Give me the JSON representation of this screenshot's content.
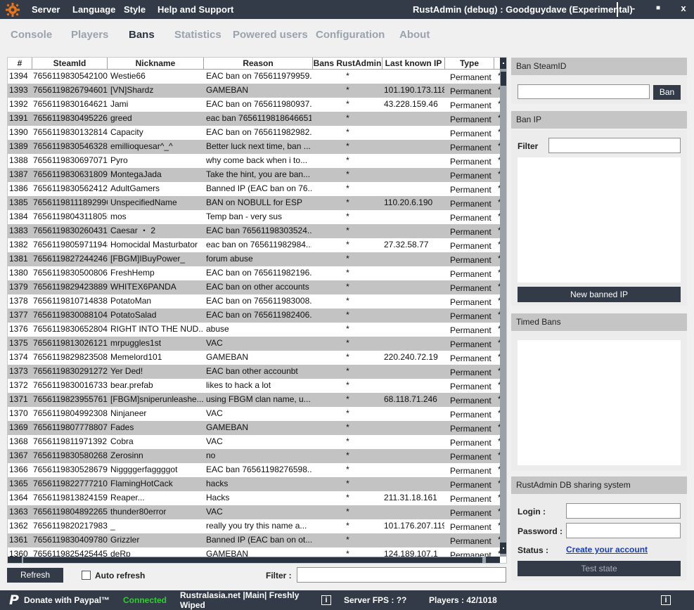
{
  "titlebar": {
    "menu": [
      "Server",
      "Language",
      "Style",
      "Help and Support"
    ],
    "title": "RustAdmin (debug) : Goodguydave (Experimental)",
    "minimize": "-",
    "maximize": "■",
    "close": "x"
  },
  "tabs": [
    "Console",
    "Players",
    "Bans",
    "Statistics",
    "Powered users",
    "Configuration",
    "About"
  ],
  "grid": {
    "columns": [
      "#",
      "SteamId",
      "Nickname",
      "Reason",
      "Bans RustAdmin",
      "Last known IP",
      "Type"
    ],
    "rows": [
      [
        "1394",
        "76561198305421006",
        "Westie66",
        "EAC ban on 765611979959...",
        "*",
        "",
        "Permanent"
      ],
      [
        "1393",
        "76561198267946018",
        "[VN]Shardz",
        "GAMEBAN",
        "*",
        "101.190.173.118",
        "Permanent"
      ],
      [
        "1392",
        "76561198301646210",
        "Jami",
        "EAC ban on 765611980937...",
        "*",
        "43.228.159.46",
        "Permanent"
      ],
      [
        "1391",
        "76561198304952269",
        "greed",
        "eac ban 76561198186466518",
        "*",
        "",
        "Permanent"
      ],
      [
        "1390",
        "76561198301328147",
        "Capacity",
        "EAC ban on 765611982982...",
        "*",
        "",
        "Permanent"
      ],
      [
        "1389",
        "76561198305463286",
        "emillioquesar^_^",
        "Better luck next time, ban ...",
        "*",
        "",
        "Permanent"
      ],
      [
        "1388",
        "76561198306970713",
        "Pyro",
        "why come back when i to...",
        "*",
        "",
        "Permanent"
      ],
      [
        "1387",
        "76561198306318098",
        "MontegaJada",
        "Take the hint, you are ban...",
        "*",
        "",
        "Permanent"
      ],
      [
        "1386",
        "76561198305624124",
        "AdultGamers",
        "Banned IP (EAC ban on 76...",
        "*",
        "",
        "Permanent"
      ],
      [
        "1385",
        "76561198111892996",
        "UnspecifiedName",
        "BAN on NOBULL for ESP",
        "*",
        "110.20.6.190",
        "Permanent"
      ],
      [
        "1384",
        "76561198043118055",
        "mos",
        "Temp ban - very sus",
        "*",
        "",
        "Permanent"
      ],
      [
        "1383",
        "76561198302604316",
        "Caesar ・ 2",
        "EAC ban 76561198303524...",
        "*",
        "",
        "Permanent"
      ],
      [
        "1382",
        "76561198059711948",
        "Homocidal Masturbator",
        "eac ban on 765611982984...",
        "*",
        "27.32.58.77",
        "Permanent"
      ],
      [
        "1381",
        "76561198272442464",
        "[FBGM]IBuyPower_",
        "forum abuse",
        "*",
        "",
        "Permanent"
      ],
      [
        "1380",
        "76561198305008061",
        "FreshHemp",
        "EAC ban on 765611982196...",
        "*",
        "",
        "Permanent"
      ],
      [
        "1379",
        "76561198294238898",
        "WHITEX6PANDA",
        "EAC ban on other accounts",
        "*",
        "",
        "Permanent"
      ],
      [
        "1378",
        "76561198107148389",
        "PotatoMan",
        "EAC ban on 765611983008...",
        "*",
        "",
        "Permanent"
      ],
      [
        "1377",
        "76561198300881040",
        "PotatoSalad",
        "EAC ban on 765611982406...",
        "*",
        "",
        "Permanent"
      ],
      [
        "1376",
        "76561198306528045",
        "RIGHT INTO THE NUD...",
        "abuse",
        "*",
        "",
        "Permanent"
      ],
      [
        "1375",
        "76561198130261211",
        "mrpuggles1st",
        "VAC",
        "*",
        "",
        "Permanent"
      ],
      [
        "1374",
        "76561198298235086",
        "Memelord101",
        "GAMEBAN",
        "*",
        "220.240.72.19",
        "Permanent"
      ],
      [
        "1373",
        "76561198302912723",
        "Yer Ded!",
        "EAC ban other accounbt",
        "*",
        "",
        "Permanent"
      ],
      [
        "1372",
        "76561198300167335",
        "bear.prefab",
        "likes to hack a lot",
        "*",
        "",
        "Permanent"
      ],
      [
        "1371",
        "76561198239557616",
        "[FBGM]sniperunleashe...",
        "using FBGM clan name, u...",
        "*",
        "68.118.71.246",
        "Permanent"
      ],
      [
        "1370",
        "76561198049923088",
        "Ninjaneer",
        "VAC",
        "*",
        "",
        "Permanent"
      ],
      [
        "1369",
        "76561198077788079",
        "Fades",
        "GAMEBAN",
        "*",
        "",
        "Permanent"
      ],
      [
        "1368",
        "76561198119713921",
        "Cobra",
        "VAC",
        "*",
        "",
        "Permanent"
      ],
      [
        "1367",
        "76561198305802684",
        "Zerosinn",
        "no",
        "*",
        "",
        "Permanent"
      ],
      [
        "1366",
        "76561198305286792",
        "Niggggerfaggggot",
        "EAC ban 76561198276598...",
        "*",
        "",
        "Permanent"
      ],
      [
        "1365",
        "76561198227772108",
        "FlamingHotCack",
        "hacks",
        "*",
        "",
        "Permanent"
      ],
      [
        "1364",
        "76561198138241598",
        "Reaper...",
        "Hacks",
        "*",
        "211.31.18.161",
        "Permanent"
      ],
      [
        "1363",
        "76561198048922656",
        "thunder80error",
        "VAC",
        "*",
        "",
        "Permanent"
      ],
      [
        "1362",
        "76561198202179834",
        "_",
        "really you try this name a...",
        "*",
        "101.176.207.119",
        "Permanent"
      ],
      [
        "1361",
        "76561198304097807",
        "Grizzler",
        "Banned IP (EAC ban on ot...",
        "*",
        "",
        "Permanent"
      ],
      [
        "1360",
        "76561198254254452",
        "deRp",
        "GAMEBAN",
        "*",
        "124.189.107.1",
        "Permanent"
      ]
    ]
  },
  "bottom": {
    "refresh": "Refresh",
    "auto_refresh": "Auto refresh",
    "filter_label": "Filter :"
  },
  "panels": {
    "ban_steamid": {
      "title": "Ban SteamID",
      "button": "Ban"
    },
    "ban_ip": {
      "title": "Ban IP",
      "filter_label": "Filter",
      "button": "New banned IP"
    },
    "timed_bans": {
      "title": "Timed Bans"
    },
    "db_sharing": {
      "title": "RustAdmin DB sharing system",
      "login_label": "Login :",
      "password_label": "Password :",
      "status_label": "Status :",
      "create_link": "Create your account",
      "test_button": "Test state"
    }
  },
  "statusbar": {
    "donate": "Donate with Paypal™",
    "paypal_glyph": "P",
    "connected": "Connected",
    "server_line1": "Rustralasia.net |Main| Freshly",
    "server_line2": "Wiped",
    "info_glyph": "i",
    "fps": "Server FPS : ??",
    "players": "Players : 42/1018",
    "connected_color": "#33cc33"
  }
}
